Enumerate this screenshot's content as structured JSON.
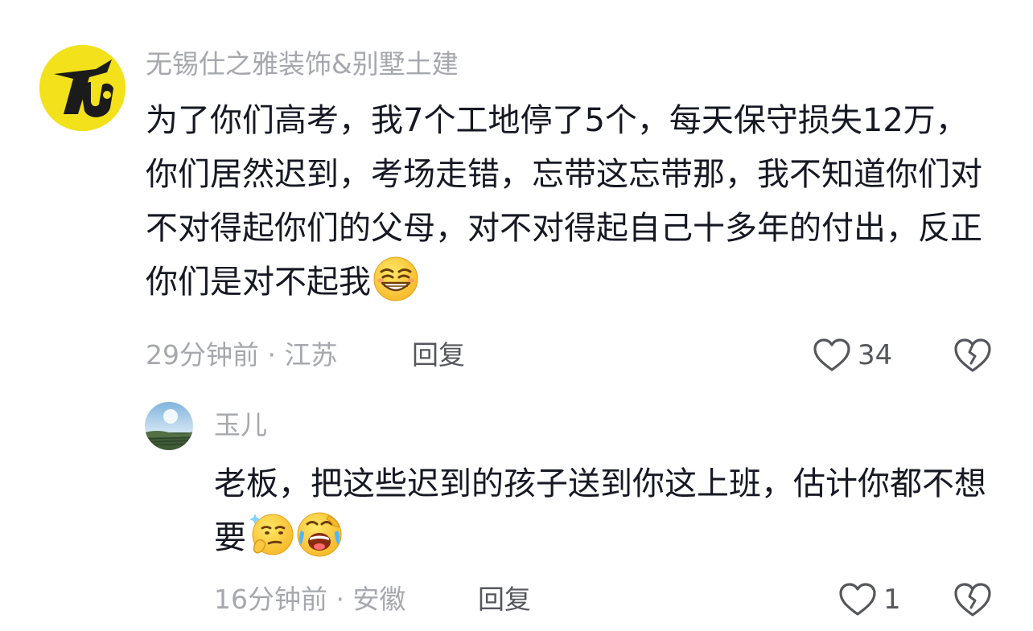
{
  "comment": {
    "username": "无锡仕之雅装饰&别墅土建",
    "text": "为了你们高考，我7个工地停了5个，每天保守损失12万，你们居然迟到，考场走错，忘带这忘带那，我不知道你们对不对得起你们的父母，对不对得起自己十多年的付出，反正你们是对不起我",
    "emojis": [
      "grin-squint-emoji"
    ],
    "time_location": "29分钟前 · 江苏",
    "reply_label": "回复",
    "like_count": "34",
    "avatar_logo": "TU"
  },
  "reply": {
    "username": "玉儿",
    "text": "老板，把这些迟到的孩子送到你这上班，估计你都不想要",
    "emojis": [
      "thinking-sparkle-emoji",
      "rolling-laugh-emoji"
    ],
    "time_location": "16分钟前 · 安徽",
    "reply_label": "回复",
    "like_count": "1"
  },
  "colors": {
    "text_primary": "#161823",
    "text_secondary": "#a6a8ad",
    "text_action": "#55575c",
    "avatar_yellow": "#f2e11b"
  }
}
